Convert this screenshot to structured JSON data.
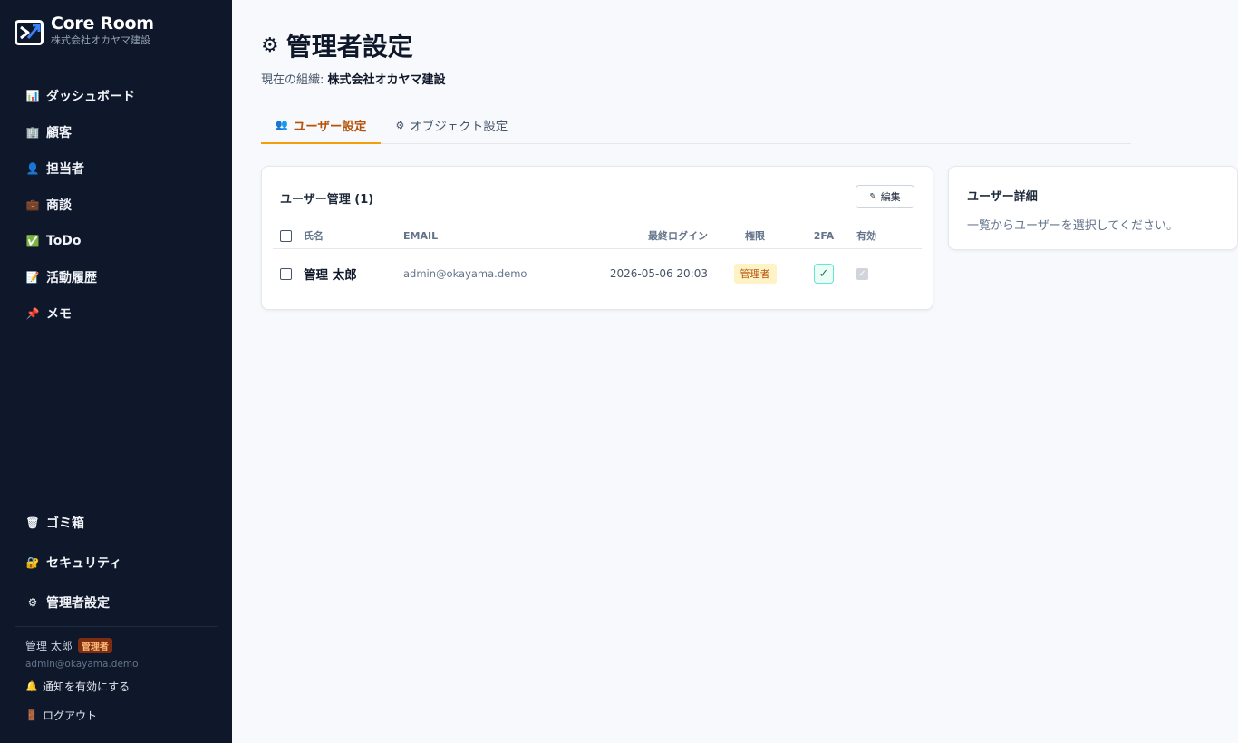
{
  "brand": {
    "name": "Core Room",
    "org": "株式会社オカヤマ建設",
    "logo_icon": "core-room-logo-icon"
  },
  "sidebar": {
    "items": [
      {
        "icon": "📊",
        "icon_name": "bar-chart-icon",
        "label": "ダッシュボード"
      },
      {
        "icon": "🏢",
        "icon_name": "building-icon",
        "label": "顧客"
      },
      {
        "icon": "👤",
        "icon_name": "person-icon",
        "label": "担当者"
      },
      {
        "icon": "💼",
        "icon_name": "briefcase-icon",
        "label": "商談"
      },
      {
        "icon": "✅",
        "icon_name": "check-box-icon",
        "label": "ToDo"
      },
      {
        "icon": "📝",
        "icon_name": "memo-icon",
        "label": "活動履歴"
      },
      {
        "icon": "📌",
        "icon_name": "pin-icon",
        "label": "メモ"
      }
    ],
    "bottom_items": [
      {
        "icon": "🗑",
        "icon_name": "trash-icon",
        "label": "ゴミ箱"
      },
      {
        "icon": "🔐",
        "icon_name": "lock-icon",
        "label": "セキュリティ"
      },
      {
        "icon": "⚙",
        "icon_name": "gear-icon",
        "label": "管理者設定"
      }
    ],
    "user": {
      "name": "管理 太郎",
      "role": "管理者",
      "email": "admin@okayama.demo"
    },
    "notify_label": "通知を有効にする",
    "notify_icon": "🔔",
    "logout_label": "ログアウト",
    "logout_icon": "🚪"
  },
  "page": {
    "title_icon": "⚙",
    "title": "管理者設定",
    "org_prefix": "現在の組織:",
    "org_name": "株式会社オカヤマ建設"
  },
  "tabs": [
    {
      "icon": "👥",
      "label": "ユーザー設定",
      "active": true
    },
    {
      "icon": "⚙",
      "label": "オブジェクト設定",
      "active": false
    }
  ],
  "users_card": {
    "title": "ユーザー管理 (1)",
    "edit_icon": "✎",
    "edit_label": "編集",
    "columns": {
      "name": "氏名",
      "email": "EMAIL",
      "last_login": "最終ログイン",
      "role": "権限",
      "twofa": "2FA",
      "enabled": "有効"
    },
    "rows": [
      {
        "name": "管理 太郎",
        "email": "admin@okayama.demo",
        "last_login": "2026-05-06 20:03",
        "role": "管理者",
        "twofa": "✓",
        "enabled": "✓"
      }
    ]
  },
  "detail_card": {
    "title": "ユーザー詳細",
    "text": "一覧からユーザーを選択してください。"
  },
  "colors": {
    "sidebar_bg": "#0f172a",
    "accent": "#f59e0b",
    "accent_text": "#b45309",
    "page_bg": "#f7f9fc"
  }
}
